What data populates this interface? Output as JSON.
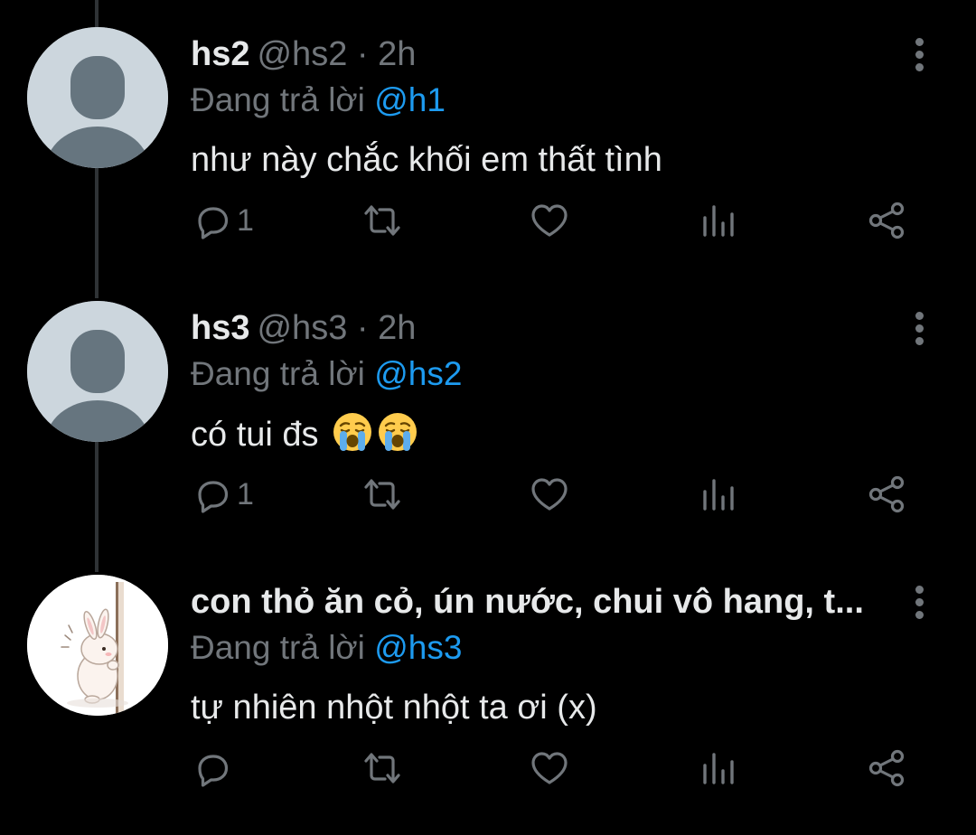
{
  "tweets": [
    {
      "display_name": "hs2",
      "handle": "@hs2",
      "time": "2h",
      "reply_prefix": "Đang trả lời",
      "reply_to": "@h1",
      "text": "như này chắc khối em thất tình",
      "emojis": [],
      "reply_count": "1",
      "avatar": "default-avatar"
    },
    {
      "display_name": "hs3",
      "handle": "@hs3",
      "time": "2h",
      "reply_prefix": "Đang trả lời",
      "reply_to": "@hs2",
      "text": "có tui đs",
      "emojis": [
        "loudly-crying-face-emoji",
        "loudly-crying-face-emoji"
      ],
      "reply_count": "1",
      "avatar": "default-avatar"
    },
    {
      "display_name": "con thỏ ăn cỏ, ún nước, chui vô hang, t...",
      "handle": "",
      "time": "",
      "reply_prefix": "Đang trả lời",
      "reply_to": "@hs3",
      "text": "tự nhiên nhột nhột ta ơi (x)",
      "emojis": [],
      "reply_count": "",
      "avatar": "bunny-avatar"
    }
  ],
  "icons": {
    "reply": "comment-icon",
    "retweet": "retweet-icon",
    "like": "heart-icon",
    "views": "analytics-icon",
    "share": "share-icon",
    "more": "more-vertical-icon"
  },
  "colors": {
    "background": "#000000",
    "text_primary": "#e7e9ea",
    "text_secondary": "#71767b",
    "mention": "#1d9bf0",
    "thread_line": "#2f3336"
  }
}
